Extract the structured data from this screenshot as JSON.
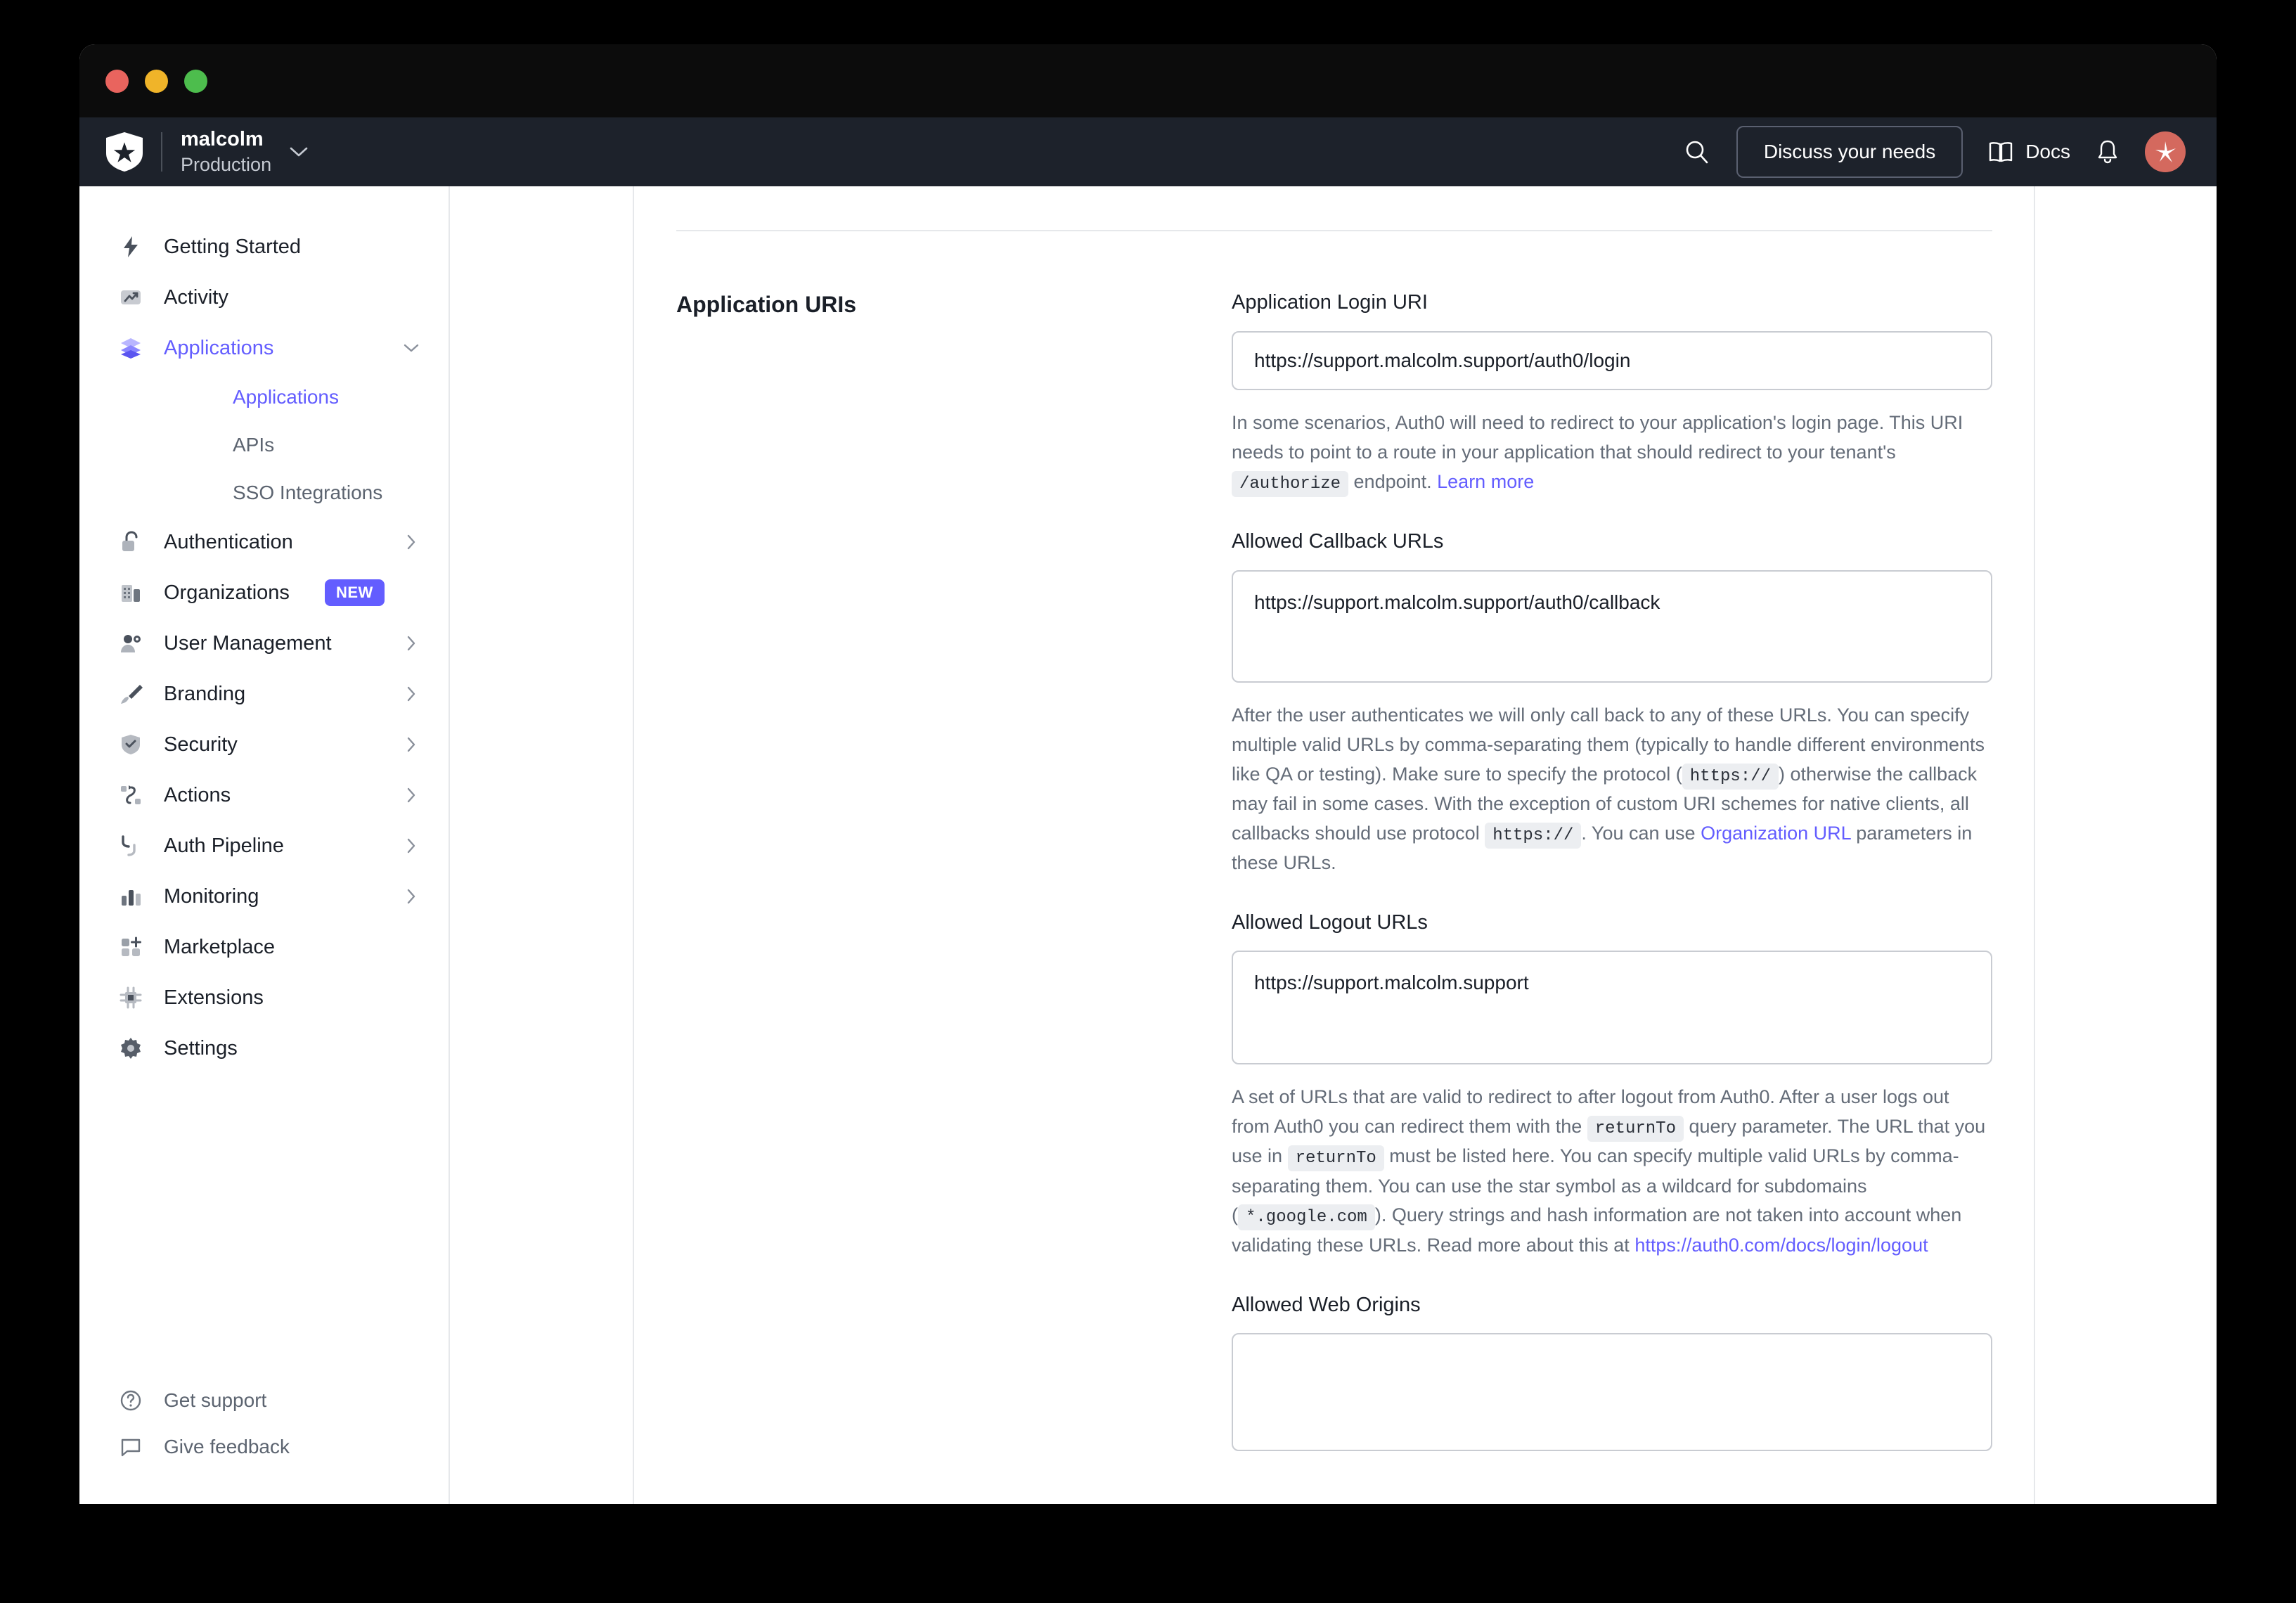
{
  "window": {
    "traffic_lights": [
      "close",
      "minimize",
      "maximize"
    ]
  },
  "topnav": {
    "logo": "auth0-shield-icon",
    "tenant_name": "malcolm",
    "tenant_env": "Production",
    "tenant_chevron": "chevron-down-icon",
    "search_icon": "search-icon",
    "discuss_button": "Discuss your needs",
    "docs_icon": "book-icon",
    "docs_label": "Docs",
    "notifications_icon": "bell-icon",
    "avatar": "user-avatar",
    "avatar_color": "#d4695e"
  },
  "sidebar": {
    "items": [
      {
        "label": "Getting Started",
        "icon": "lightning-bolt-icon",
        "chevron": false,
        "active": false
      },
      {
        "label": "Activity",
        "icon": "trending-up-icon",
        "chevron": false,
        "active": false
      },
      {
        "label": "Applications",
        "icon": "layers-icon",
        "chevron": "chevron-down-icon",
        "active": true
      },
      {
        "label": "Authentication",
        "icon": "unlock-icon",
        "chevron": "chevron-right-icon",
        "active": false
      },
      {
        "label": "Organizations",
        "icon": "building-icon",
        "chevron": false,
        "active": false,
        "badge": "NEW"
      },
      {
        "label": "User Management",
        "icon": "user-gear-icon",
        "chevron": "chevron-right-icon",
        "active": false
      },
      {
        "label": "Branding",
        "icon": "paintbrush-icon",
        "chevron": "chevron-right-icon",
        "active": false
      },
      {
        "label": "Security",
        "icon": "shield-check-icon",
        "chevron": "chevron-right-icon",
        "active": false
      },
      {
        "label": "Actions",
        "icon": "flow-nodes-icon",
        "chevron": "chevron-right-icon",
        "active": false
      },
      {
        "label": "Auth Pipeline",
        "icon": "pipeline-arrow-icon",
        "chevron": "chevron-right-icon",
        "active": false
      },
      {
        "label": "Monitoring",
        "icon": "bar-chart-icon",
        "chevron": "chevron-right-icon",
        "active": false
      },
      {
        "label": "Marketplace",
        "icon": "grid-plus-icon",
        "chevron": false,
        "active": false
      },
      {
        "label": "Extensions",
        "icon": "chip-icon",
        "chevron": false,
        "active": false
      },
      {
        "label": "Settings",
        "icon": "gear-icon",
        "chevron": false,
        "active": false
      }
    ],
    "sub_items": [
      {
        "label": "Applications",
        "active": true
      },
      {
        "label": "APIs",
        "active": false
      },
      {
        "label": "SSO Integrations",
        "active": false
      }
    ],
    "footer": [
      {
        "label": "Get support",
        "icon": "question-circle-icon"
      },
      {
        "label": "Give feedback",
        "icon": "speech-bubble-icon"
      }
    ],
    "accent_color": "#635dff"
  },
  "main": {
    "section_title": "Application URIs",
    "fields": {
      "login_uri": {
        "label": "Application Login URI",
        "value": "https://support.malcolm.support/auth0/login",
        "help_1": "In some scenarios, Auth0 will need to redirect to your application's login page. This URI needs to point to a route in your application that should redirect to your tenant's ",
        "help_chip": "/authorize",
        "help_2": " endpoint. ",
        "help_link": "Learn more"
      },
      "callback_urls": {
        "label": "Allowed Callback URLs",
        "value": "https://support.malcolm.support/auth0/callback",
        "help_1": "After the user authenticates we will only call back to any of these URLs. You can specify multiple valid URLs by comma-separating them (typically to handle different environments like QA or testing). Make sure to specify the protocol (",
        "help_chip_1": "https://",
        "help_2": ") otherwise the callback may fail in some cases. With the exception of custom URI schemes for native clients, all callbacks should use protocol ",
        "help_chip_2": "https://",
        "help_3": ". You can use ",
        "help_link": "Organization URL",
        "help_4": " parameters in these URLs."
      },
      "logout_urls": {
        "label": "Allowed Logout URLs",
        "value": "https://support.malcolm.support",
        "help_1": "A set of URLs that are valid to redirect to after logout from Auth0. After a user logs out from Auth0 you can redirect them with the ",
        "help_chip_1": "returnTo",
        "help_2": " query parameter. The URL that you use in ",
        "help_chip_2": "returnTo",
        "help_3": " must be listed here. You can specify multiple valid URLs by comma-separating them. You can use the star symbol as a wildcard for subdomains (",
        "help_chip_3": "*.google.com",
        "help_4": "). Query strings and hash information are not taken into account when validating these URLs. Read more about this at ",
        "help_link": "https://auth0.com/docs/login/logout"
      },
      "web_origins": {
        "label": "Allowed Web Origins",
        "value": ""
      }
    }
  }
}
